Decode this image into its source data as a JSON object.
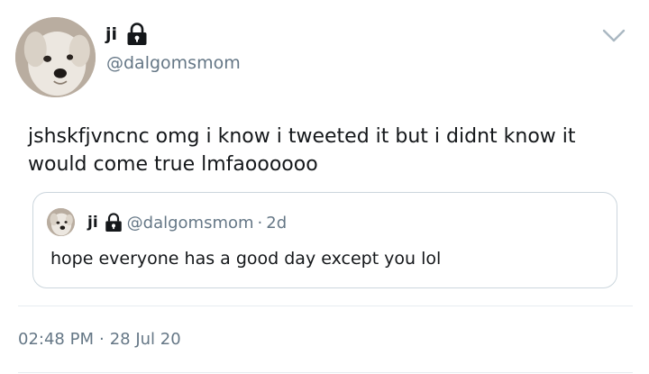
{
  "author": {
    "display_name": "ji",
    "handle": "@dalgomsmom",
    "avatar_icon": "dog-avatar",
    "protected_icon": "lock-icon"
  },
  "tweet": {
    "text": "jshskfjvncnc omg i know i tweeted it but i didnt know it would come true lmfaoooooo",
    "time": "02:48 PM",
    "separator": "·",
    "date": "28 Jul 20"
  },
  "quoted_tweet": {
    "display_name": "ji",
    "handle": "@dalgomsmom",
    "separator": "·",
    "age": "2d",
    "text": "hope everyone has a good day except you lol"
  },
  "menu": {
    "icon": "chevron-down-icon"
  },
  "colors": {
    "text_primary": "#14171a",
    "text_secondary": "#657786",
    "border": "#ccd6dd",
    "divider": "#e6ecf0"
  }
}
